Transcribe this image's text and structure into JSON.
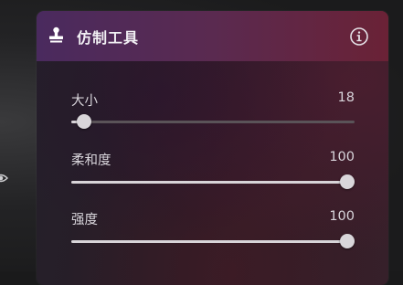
{
  "panel": {
    "title": "仿制工具",
    "title_icon": "stamp-icon",
    "info_icon": "info-icon"
  },
  "sliders": [
    {
      "label": "大小",
      "value": "18",
      "level": 0.045
    },
    {
      "label": "柔和度",
      "value": "100",
      "level": 1.0
    },
    {
      "label": "强度",
      "value": "100",
      "level": 1.0
    }
  ],
  "sidebar": {
    "icon": "eye-icon"
  },
  "colors": {
    "header_start": "#4a2a5e",
    "header_end": "#6a2236",
    "text": "#d9d6dc",
    "thumb": "#d9d6da"
  }
}
